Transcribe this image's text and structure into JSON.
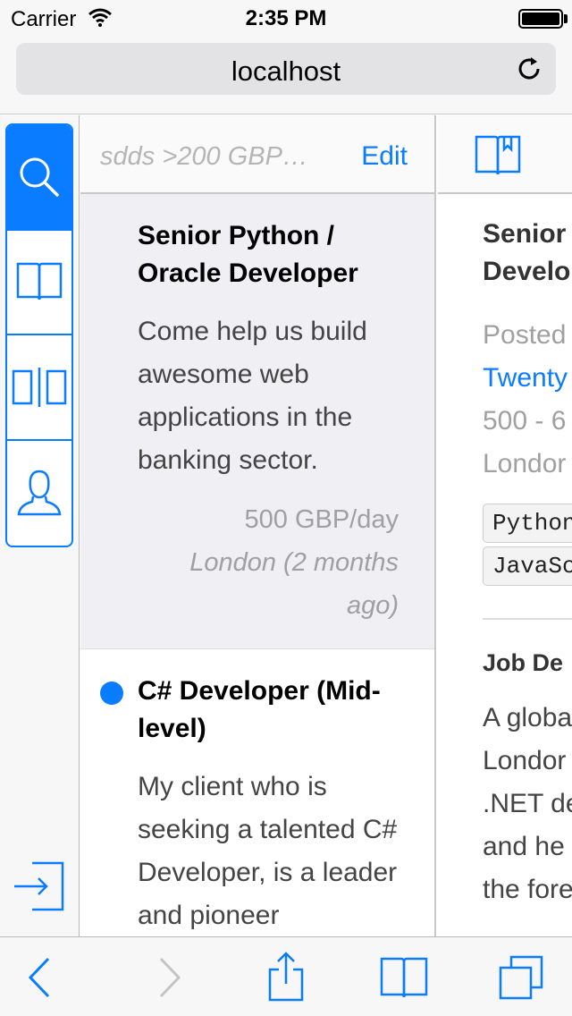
{
  "status_bar": {
    "carrier": "Carrier",
    "time": "2:35 PM"
  },
  "browser": {
    "url": "localhost"
  },
  "sidebar": {
    "items": [
      {
        "name": "search",
        "icon": "search-icon",
        "active": true
      },
      {
        "name": "bookmarks",
        "icon": "book-icon",
        "active": false
      },
      {
        "name": "compare",
        "icon": "split-view-icon",
        "active": false
      },
      {
        "name": "profile",
        "icon": "user-icon",
        "active": false
      }
    ],
    "logout_icon": "logout-icon"
  },
  "list": {
    "filter": "sdds >200 GBP…",
    "edit_label": "Edit",
    "jobs": [
      {
        "title": "Senior Python / Oracle Developer",
        "description": "Come help us build awesome web applications in the banking sector.",
        "rate": "500 GBP/day",
        "location": "London (2 months ago)",
        "selected": true,
        "unread": false
      },
      {
        "title": "C# Developer (Mid-level)",
        "description": "My client who is seeking a talented C# Developer, is a leader and pioneer",
        "selected": false,
        "unread": true
      }
    ]
  },
  "detail": {
    "title_line1": "Senior",
    "title_line2": "Develo",
    "posted": "Posted",
    "company": "Twenty",
    "rate": "500 - 6",
    "location": "Londor",
    "tags": [
      "Python",
      "JavaSc"
    ],
    "section": "Job De",
    "text": [
      "A globa",
      "Londor",
      ".NET de",
      "and he",
      "the fore"
    ]
  },
  "colors": {
    "accent": "#0a7cff"
  }
}
